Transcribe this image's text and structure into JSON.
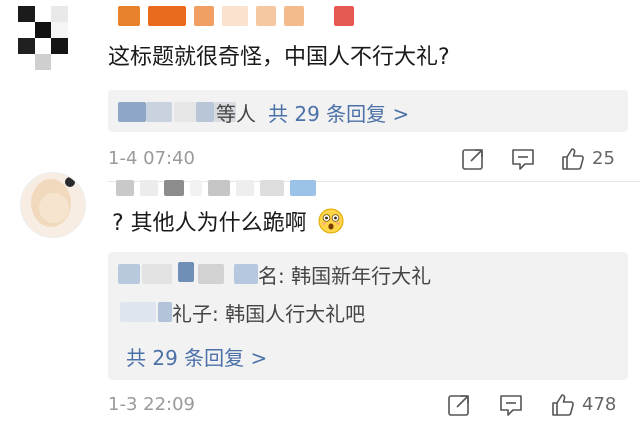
{
  "comments": [
    {
      "text": "这标题就很奇怪，中国人不行大礼?",
      "reply_preview_suffix": "等人",
      "reply_count": "共 29 条回复 >",
      "timestamp": "1-4 07:40",
      "likes": "25",
      "icons": [
        "share-icon",
        "comment-icon",
        "like-icon"
      ]
    },
    {
      "text": "? 其他人为什么跪啊",
      "emoji": "astonished-face-emoji",
      "replies": [
        {
          "suffix": "名: 韩国新年行大礼"
        },
        {
          "suffix": "礼子: 韩国人行大礼吧"
        }
      ],
      "reply_count": "共 29 条回复 >",
      "timestamp": "1-3 22:09",
      "likes": "478",
      "icons": [
        "share-icon",
        "comment-icon",
        "like-icon"
      ]
    }
  ],
  "colors": {
    "link": "#4b71a8",
    "timestamp": "#9a9a9a",
    "reply_bg": "#f2f2f2"
  }
}
